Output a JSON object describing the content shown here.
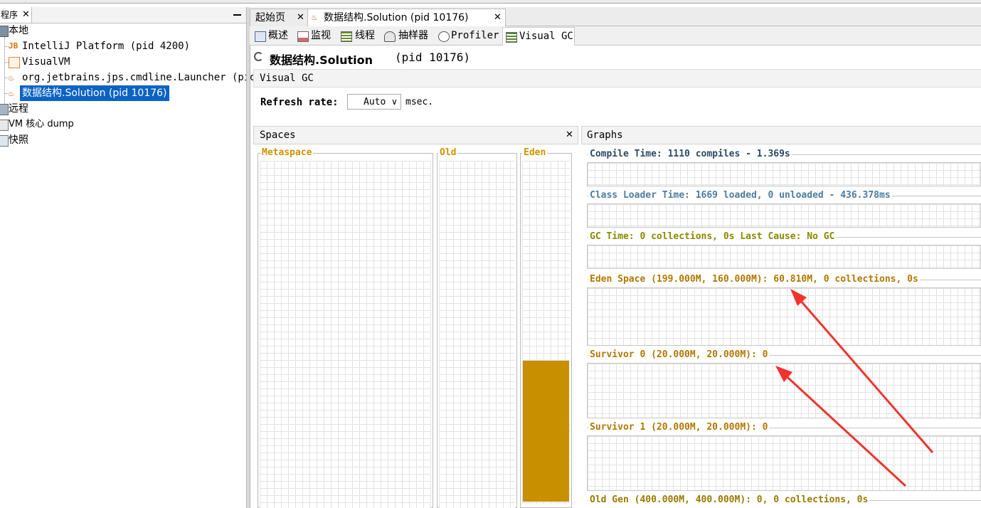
{
  "left_panel": {
    "tab_label": "程序",
    "tree": {
      "local": "本地",
      "local_items": [
        "IntelliJ Platform (pid 4200)",
        "VisualVM",
        "org.jetbrains.jps.cmdline.Launcher (pid",
        "数据结构.Solution (pid 10176)"
      ],
      "remote": "远程",
      "vm_core_dump": "VM 核心 dump",
      "snapshots": "快照"
    }
  },
  "doc_tabs": [
    "起始页",
    "数据结构.Solution (pid 10176)"
  ],
  "sub_tabs": [
    "概述",
    "监视",
    "线程",
    "抽样器",
    "Profiler",
    "Visual GC"
  ],
  "title": {
    "name": "数据结构.Solution",
    "pid": "(pid 10176)"
  },
  "visual_gc_label": "Visual GC",
  "refresh": {
    "label": "Refresh rate:",
    "value": "Auto",
    "unit": "msec."
  },
  "spaces_panel": {
    "title": "Spaces",
    "metaspace_label": "Metaspace",
    "old_label": "Old",
    "eden_label": "Eden",
    "eden_fill_fraction": 0.41,
    "fill_color": "#c88f00"
  },
  "graphs_panel": {
    "title": "Graphs",
    "graphs": [
      {
        "title": "Compile Time: 1110 compiles - 1.369s",
        "color": "#2b4a67"
      },
      {
        "title": "Class Loader Time: 1669 loaded, 0 unloaded - 436.378ms",
        "color": "#4b7da3"
      },
      {
        "title": "GC Time: 0 collections, 0s Last Cause: No GC",
        "color": "#8a8a00"
      },
      {
        "title": "Eden Space (199.000M, 160.000M): 60.810M, 0 collections, 0s",
        "color": "#b07800"
      },
      {
        "title": "Survivor 0 (20.000M, 20.000M): 0",
        "color": "#b07800"
      },
      {
        "title": "Survivor 1 (20.000M, 20.000M): 0",
        "color": "#b07800"
      },
      {
        "title": "Old Gen (400.000M, 400.000M): 0, 0 collections, 0s",
        "color": "#9a7a00"
      }
    ]
  },
  "annotation_color": "#f0332f"
}
